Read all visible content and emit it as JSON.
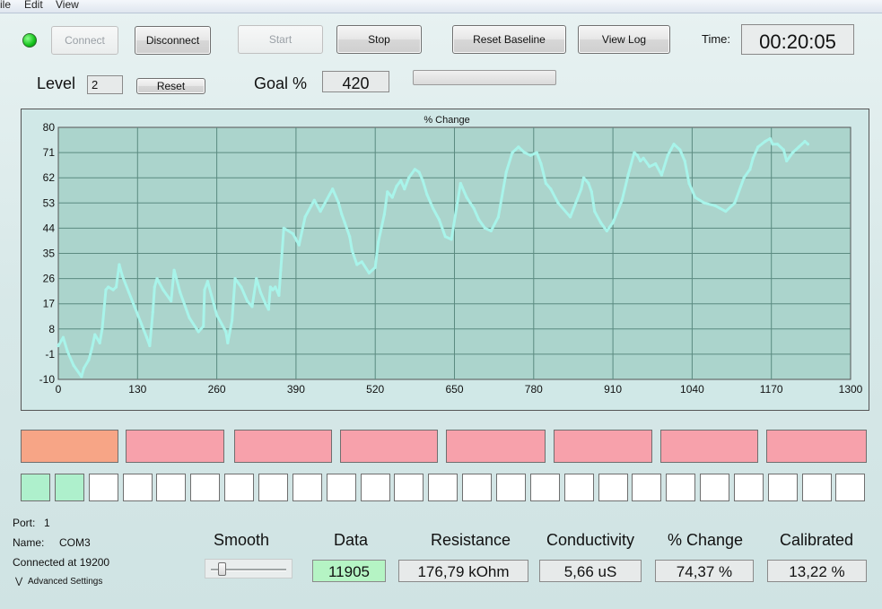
{
  "menu": [
    "ile",
    "Edit",
    "View"
  ],
  "toolbar": {
    "connect": "Connect",
    "disconnect": "Disconnect",
    "start": "Start",
    "stop": "Stop",
    "reset_baseline": "Reset Baseline",
    "view_log": "View Log",
    "time_label": "Time:",
    "time_value": "00:20:05"
  },
  "level": {
    "label": "Level",
    "value": "2",
    "reset": "Reset"
  },
  "goal": {
    "label": "Goal %",
    "value": "420",
    "progress": 0
  },
  "chart_data": {
    "type": "line",
    "title": "% Change",
    "xlabel": "",
    "ylabel": "",
    "xlim": [
      0,
      1300
    ],
    "ylim": [
      -10,
      80
    ],
    "xticks": [
      0,
      130,
      260,
      390,
      520,
      650,
      780,
      910,
      1040,
      1170,
      1300
    ],
    "yticks": [
      -10,
      -1,
      8,
      17,
      26,
      35,
      44,
      53,
      62,
      71,
      80
    ],
    "grid": true,
    "color": "#a8f4ea",
    "background": "#abd4cc",
    "series": [
      {
        "x": [
          0,
          8,
          15,
          25,
          38,
          42,
          50,
          55,
          60,
          68,
          72,
          78,
          82,
          90,
          95,
          100,
          105,
          125,
          145,
          150,
          155,
          158,
          162,
          172,
          185,
          190,
          200,
          215,
          230,
          238,
          240,
          245,
          260,
          275,
          278,
          285,
          290,
          300,
          310,
          318,
          325,
          332,
          340,
          345,
          348,
          352,
          356,
          362,
          365,
          370,
          385,
          395,
          405,
          415,
          420,
          430,
          445,
          450,
          460,
          465,
          470,
          478,
          482,
          490,
          498,
          510,
          520,
          525,
          530,
          535,
          540,
          548,
          555,
          562,
          568,
          575,
          585,
          592,
          598,
          605,
          615,
          625,
          635,
          645,
          660,
          670,
          682,
          690,
          700,
          710,
          722,
          735,
          745,
          755,
          765,
          775,
          785,
          792,
          800,
          808,
          820,
          840,
          858,
          862,
          870,
          875,
          880,
          890,
          900,
          910,
          925,
          935,
          945,
          950,
          955,
          960,
          970,
          980,
          990,
          1000,
          1005,
          1010,
          1020,
          1028,
          1035,
          1045,
          1060,
          1078,
          1095,
          1110,
          1125,
          1135,
          1140,
          1148,
          1160,
          1168,
          1172,
          1180,
          1190,
          1195,
          1205,
          1215,
          1225,
          1230
        ],
        "y": [
          2,
          5,
          0,
          -5,
          -9,
          -6,
          -3,
          1,
          6,
          3,
          8,
          22,
          23,
          22,
          23,
          31,
          27,
          16,
          5,
          2,
          14,
          23,
          26,
          22,
          18,
          29,
          21,
          12,
          7,
          9,
          22,
          25,
          13,
          7,
          3,
          11,
          26,
          23,
          18,
          16,
          26,
          21,
          17,
          15,
          23,
          22,
          23,
          20,
          29,
          44,
          42,
          38,
          48,
          52,
          54,
          50,
          56,
          58,
          53,
          49,
          46,
          41,
          36,
          31,
          32,
          28,
          30,
          39,
          44,
          49,
          57,
          55,
          59,
          61,
          58,
          62,
          65,
          64,
          61,
          56,
          51,
          47,
          41,
          40,
          60,
          55,
          51,
          47,
          44,
          43,
          48,
          64,
          71,
          73,
          71,
          70,
          71,
          67,
          60,
          58,
          53,
          48,
          58,
          62,
          60,
          57,
          50,
          46,
          43,
          46,
          54,
          63,
          71,
          70,
          68,
          69,
          66,
          67,
          63,
          70,
          72,
          74,
          72,
          68,
          60,
          55,
          53,
          52,
          50,
          53,
          62,
          65,
          69,
          73,
          75,
          76,
          74,
          74,
          72,
          68,
          71,
          73,
          75,
          74
        ]
      }
    ]
  },
  "blocks": {
    "red": [
      {
        "color": "#f7a586"
      },
      {
        "color": "#f7a1ab"
      },
      {
        "color": "#f7a1ab"
      },
      {
        "color": "#f7a1ab"
      },
      {
        "color": "#f7a1ab"
      },
      {
        "color": "#f7a1ab"
      },
      {
        "color": "#f7a1ab"
      },
      {
        "color": "#f7a1ab"
      }
    ],
    "squares_filled": 2,
    "squares_total": 25,
    "filled_color": "#aef0cc"
  },
  "port": {
    "port_label": "Port:",
    "port_value": "1",
    "name_label": "Name:",
    "name_value": "COM3",
    "connected_text": "Connected at 19200",
    "advanced_settings": "Advanced Settings"
  },
  "readouts": {
    "smooth_label": "Smooth",
    "smooth_level": 0.1,
    "data_label": "Data",
    "data_value": "11905",
    "data_color": "#b5f4c4",
    "resistance_label": "Resistance",
    "resistance_value": "176,79 kOhm",
    "conductivity_label": "Conductivity",
    "conductivity_value": "5,66 uS",
    "change_label": "% Change",
    "change_value": "74,37 %",
    "calibrated_label": "Calibrated",
    "calibrated_value": "13,22 %"
  }
}
